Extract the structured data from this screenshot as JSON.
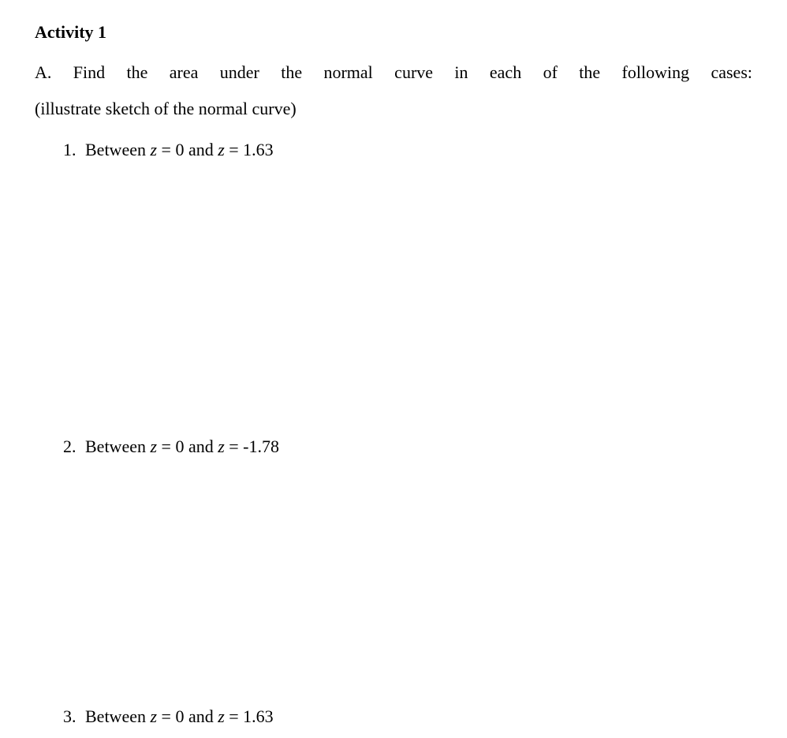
{
  "title": "Activity 1",
  "instruction": "A. Find the area under the normal curve in each of the following cases:",
  "sub_instruction": "(illustrate sketch of the normal curve)",
  "items": [
    {
      "number": "1.",
      "prefix": "Between ",
      "var1": "z",
      "eq1": " = 0 and ",
      "var2": "z",
      "eq2": " = 1.63"
    },
    {
      "number": "2.",
      "prefix": "Between ",
      "var1": "z",
      "eq1": " = 0 and ",
      "var2": "z",
      "eq2": " = -1.78"
    },
    {
      "number": "3.",
      "prefix": "Between ",
      "var1": "z",
      "eq1": " = 0 and ",
      "var2": "z",
      "eq2": " = 1.63"
    }
  ]
}
